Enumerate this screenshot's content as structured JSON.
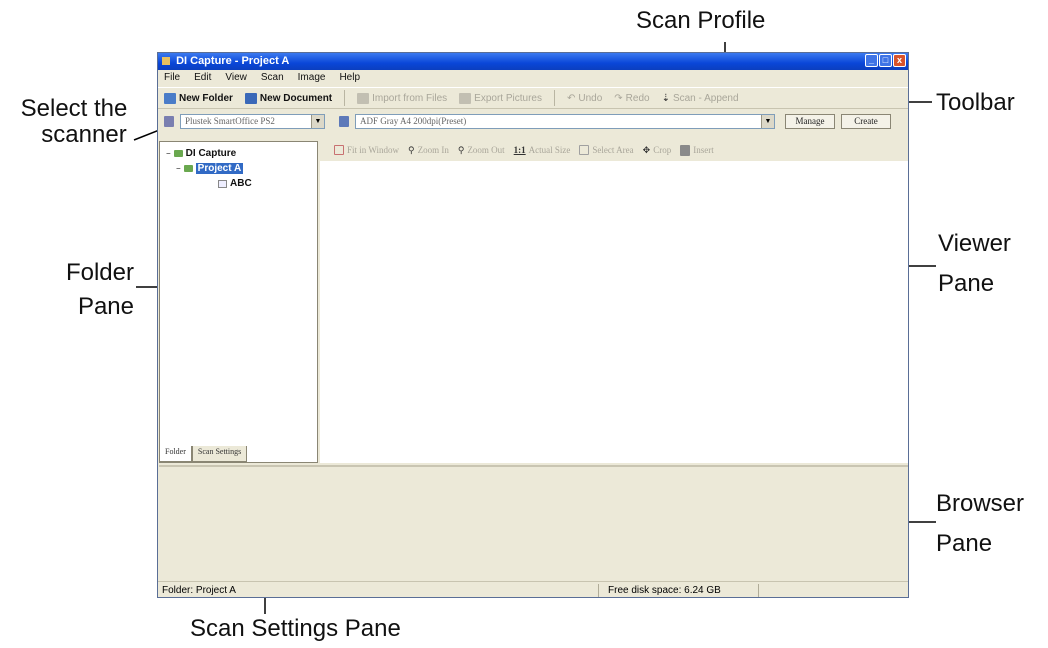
{
  "window": {
    "title": "DI Capture - Project A",
    "buttons": [
      "_",
      "□",
      "x"
    ]
  },
  "menu": [
    "File",
    "Edit",
    "View",
    "Scan",
    "Image",
    "Help"
  ],
  "toolbar": {
    "new_folder": "New Folder",
    "new_document": "New Document",
    "import_files": "Import from Files",
    "export_pictures": "Export Pictures",
    "undo": "Undo",
    "redo": "Redo",
    "scan_append": "Scan - Append"
  },
  "scanner": {
    "selected": "Plustek SmartOffice PS2",
    "profile": "ADF Gray A4 200dpi(Preset)",
    "manage_label": "Manage",
    "create_label": "Create"
  },
  "viewer_toolbar": {
    "fit": "Fit in Window",
    "zoom_in": "Zoom In",
    "zoom_out": "Zoom Out",
    "actual_prefix": "1:1",
    "actual": "Actual Size",
    "select_area": "Select Area",
    "crop": "Crop",
    "insert": "Insert"
  },
  "folder_tree": {
    "root": "DI Capture",
    "project": "Project A",
    "document": "ABC"
  },
  "pane_tabs": [
    "Folder",
    "Scan Settings"
  ],
  "status": {
    "folder": "Folder: Project A",
    "disk": "Free disk space: 6.24 GB"
  },
  "annotations": {
    "scan_profile": "Scan Profile",
    "select_scanner_line1": "Select the",
    "select_scanner_line2": "scanner",
    "toolbar": "Toolbar",
    "viewer_line1": "Viewer",
    "viewer_line2": "Pane",
    "folder_line1": "Folder",
    "folder_line2": "Pane",
    "browser_line1": "Browser",
    "browser_line2": "Pane",
    "scan_settings": "Scan Settings Pane"
  },
  "colors": {
    "title_bar": "#0a46d8",
    "selection": "#316ac5",
    "chrome": "#ece9d8"
  }
}
